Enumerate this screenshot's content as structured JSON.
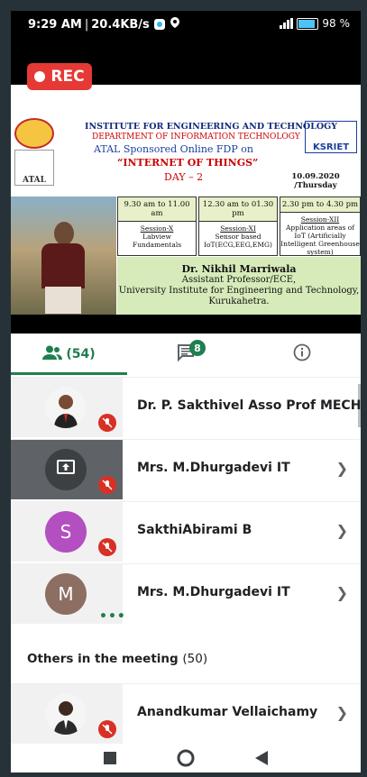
{
  "status_bar": {
    "time": "9:29 AM",
    "speed": "20.4KB/s",
    "battery": "98"
  },
  "video": {
    "rec_label": "REC",
    "slide": {
      "institute": "INSTITUTE FOR ENGINEERING AND TECHNOLOGY",
      "department": "DEPARTMENT OF INFORMATION TECHNOLOGY",
      "program": "ATAL Sponsored Online FDP on",
      "topic": "“INTERNET OF THINGS”",
      "day": "DAY – 2",
      "date": "10.09.2020 /Thursday",
      "left_logo_text": "ATAL",
      "right_logo_text": "KSRIET",
      "sessions": [
        {
          "time": "9.30 am to 11.00 am",
          "name": "Session-X",
          "desc": "Labview Fundamentals"
        },
        {
          "time": "12.30 am to 01.30 pm",
          "name": "Session-XI",
          "desc": "Sensor based IoT(ECG,EEG,EMG)"
        },
        {
          "time": "2.30 pm to 4.30 pm",
          "name": "Session-XII",
          "desc": "Application areas of IoT (Artificially Intelligent Greenhouse system)"
        }
      ],
      "speaker_name": "Dr. Nikhil Marriwala",
      "speaker_role": "Assistant Professor/ECE,",
      "speaker_org": "University Institute for Engineering and Technology,",
      "speaker_city": "Kurukahetra."
    }
  },
  "tabs": {
    "people_count": "(54)",
    "chat_badge": "8"
  },
  "participants": [
    {
      "name": "Dr. P. Sakthivel Asso Prof MECH (Y...",
      "avatar": "photo"
    },
    {
      "name": "Mrs. M.Dhurgadevi IT",
      "avatar": "present"
    },
    {
      "name": "SakthiAbirami B",
      "avatar": "S"
    },
    {
      "name": "Mrs. M.Dhurgadevi IT",
      "avatar": "M"
    },
    {
      "name": "Anandkumar Vellaichamy",
      "avatar": "photo"
    }
  ],
  "section": {
    "label": "Others in the meeting",
    "count": "(50)"
  },
  "colors": {
    "accent": "#1e7f4f",
    "rec": "#e53935",
    "mic_off": "#d93025",
    "avatar_s": "#b34fc0",
    "avatar_m": "#8d6e63"
  }
}
